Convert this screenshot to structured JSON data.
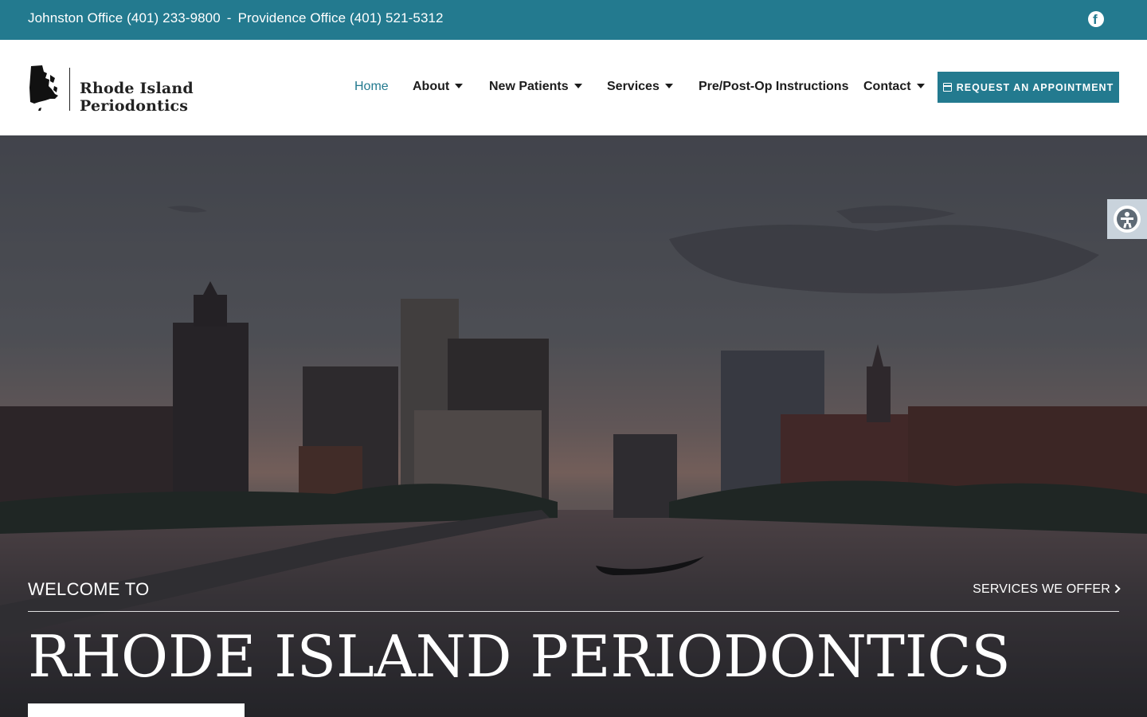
{
  "topbar": {
    "johnston": "Johnston Office (401) 233-9800",
    "separator": "-",
    "providence": "Providence Office (401) 521-5312",
    "social_icon": "facebook-icon",
    "bg_color": "#237a8f"
  },
  "header": {
    "logo_text": "Rhode Island Periodontics",
    "nav": [
      {
        "label": "Home",
        "active": true
      },
      {
        "label": "About",
        "dropdown": true
      },
      {
        "label": "New Patients",
        "dropdown": true
      },
      {
        "label": "Services",
        "dropdown": true
      },
      {
        "label": "Pre/Post-Op Instructions"
      },
      {
        "label": "Contact",
        "dropdown": true
      }
    ],
    "cta_label": "REQUEST AN APPOINTMENT",
    "cta_icon": "calendar-icon"
  },
  "hero": {
    "eyebrow": "WELCOME TO",
    "services_link": "SERVICES WE OFFER",
    "title": "RHODE ISLAND PERIODONTICS",
    "accessibility_icon": "accessibility-icon"
  }
}
